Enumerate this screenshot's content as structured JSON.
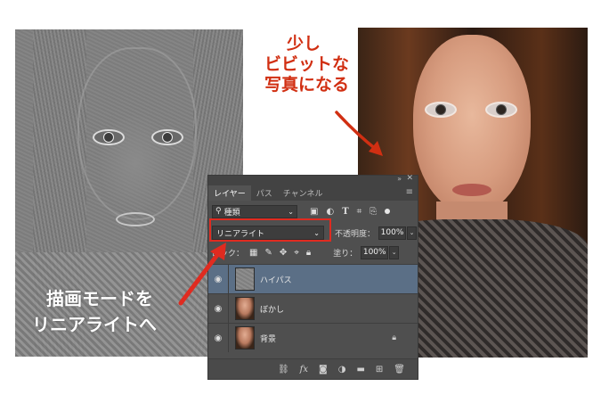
{
  "annotations": {
    "top_lines": [
      "少し",
      "ビビットな",
      "写真になる"
    ],
    "bottom_lines": [
      "描画モードを",
      "リニアライトへ"
    ]
  },
  "panel": {
    "tabs": [
      "レイヤー",
      "パス",
      "チャンネル"
    ],
    "active_tab": 0,
    "filter": {
      "label": "種類",
      "icon": "search-icon"
    },
    "filter_icons": [
      "image-filter-icon",
      "adjustment-filter-icon",
      "type-filter-icon",
      "shape-filter-icon",
      "smart-object-filter-icon"
    ],
    "blend_mode": "リニアライト",
    "opacity_label": "不透明度：",
    "opacity_value": "100%",
    "lock_label": "ロック：",
    "fill_label": "塗り：",
    "fill_value": "100%",
    "layers": [
      {
        "name": "ハイパス",
        "thumb": "gray",
        "visible": true,
        "selected": true,
        "locked": false
      },
      {
        "name": "ぼかし",
        "thumb": "color",
        "visible": true,
        "selected": false,
        "locked": false
      },
      {
        "name": "背景",
        "thumb": "color",
        "visible": true,
        "selected": false,
        "locked": true
      }
    ],
    "bottom_icons": [
      "link-layers-icon",
      "fx-icon",
      "add-mask-icon",
      "adjustment-layer-icon",
      "new-group-icon",
      "new-layer-icon",
      "delete-layer-icon"
    ]
  },
  "colors": {
    "annotation_red": "#d12f12",
    "highlight_box": "#e02b20",
    "selected_layer": "#5b6f86"
  }
}
